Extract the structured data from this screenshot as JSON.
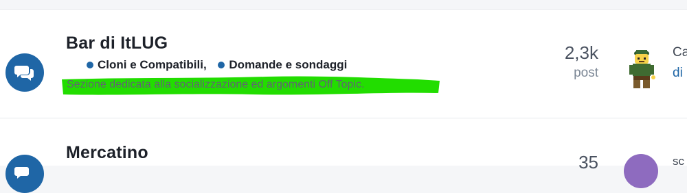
{
  "forums": [
    {
      "title": "Bar di ItLUG",
      "subforums": [
        "Cloni e Compatibili,",
        "Domande e sondaggi"
      ],
      "description": "Sezione dedicata alla socializzazione ed argomenti Off Topic.",
      "stat_value": "2,3k",
      "stat_label": "post",
      "last_post_title": "Ca",
      "last_post_sub": "di",
      "colors": {
        "icon_bg": "#1f66a6",
        "highlight": "#22dd00",
        "link": "#1f66a6"
      }
    },
    {
      "title": "Mercatino",
      "stat_value": "35",
      "last_post_title": "sc",
      "colors": {
        "icon_bg": "#1f66a6",
        "avatar_bg": "#8e6bbf"
      }
    }
  ],
  "icons": {
    "forum_icon": "chat-bubbles-icon",
    "user_avatar": "lego-minifigure-avatar"
  }
}
